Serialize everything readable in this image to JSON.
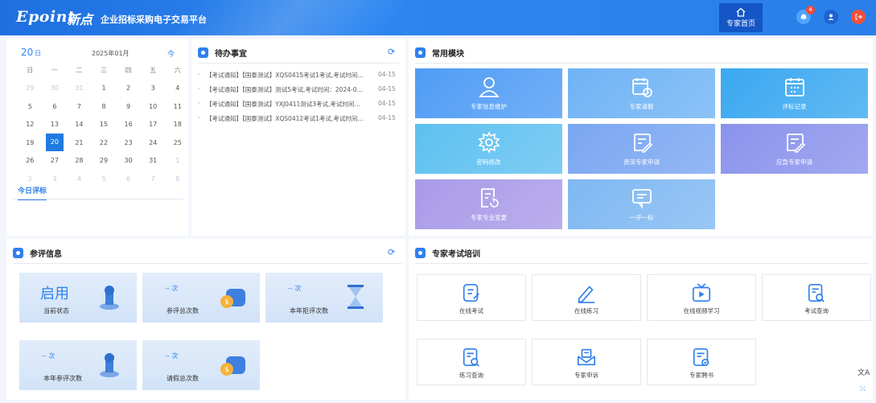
{
  "header": {
    "logo_text": "Epoint",
    "logo_cn": "新点",
    "title": "企业招标采购电子交易平台",
    "home_label": "专家首页",
    "notification_count": "4"
  },
  "calendar": {
    "day": "20",
    "day_unit": "日",
    "month": "2025年01月",
    "today_btn": "今",
    "weekdays": [
      "日",
      "一",
      "二",
      "三",
      "四",
      "五",
      "六"
    ],
    "weeks": [
      [
        "29",
        "30",
        "31",
        "1",
        "2",
        "3",
        "4"
      ],
      [
        "5",
        "6",
        "7",
        "8",
        "9",
        "10",
        "11"
      ],
      [
        "12",
        "13",
        "14",
        "15",
        "16",
        "17",
        "18"
      ],
      [
        "19",
        "20",
        "21",
        "22",
        "23",
        "24",
        "25"
      ],
      [
        "26",
        "27",
        "28",
        "29",
        "30",
        "31",
        "1"
      ],
      [
        "2",
        "3",
        "4",
        "5",
        "6",
        "7",
        "8"
      ]
    ],
    "today_review": "今日评标"
  },
  "todo": {
    "title": "待办事宜",
    "items": [
      {
        "text": "【考试通知】【国泰测试】XQS0415考试1考试,考试时间…",
        "date": "04-15"
      },
      {
        "text": "【考试通知】【国泰测试】测试5考试,考试时间：2024-0…",
        "date": "04-15"
      },
      {
        "text": "【考试通知】【国泰测试】YXJ0411测试3考试,考试时间…",
        "date": "04-15"
      },
      {
        "text": "【考试通知】【国泰测试】XQS0412考试1考试,考试时间…",
        "date": "04-15"
      }
    ]
  },
  "modules": {
    "title": "常用模块",
    "tiles": [
      {
        "label": "专家信息维护",
        "icon": "user-icon",
        "color": "#4f9cf5"
      },
      {
        "label": "专家请假",
        "icon": "calendar-clock-icon",
        "color": "#6fb3f5"
      },
      {
        "label": "评标记录",
        "icon": "calendar-icon",
        "color": "#3aa8f0"
      },
      {
        "label": "密码修改",
        "icon": "gear-icon",
        "color": "#5ec0f0"
      },
      {
        "label": "资深专家申请",
        "icon": "edit-doc-icon",
        "color": "#7aa6f2"
      },
      {
        "label": "应急专家申请",
        "icon": "edit-doc-icon",
        "color": "#8a93ec"
      },
      {
        "label": "专家专业变更",
        "icon": "doc-refresh-icon",
        "color": "#a99ae8"
      },
      {
        "label": "一评一标",
        "icon": "message-icon",
        "color": "#7fb8f2"
      }
    ]
  },
  "review": {
    "title": "参评信息",
    "stats": [
      {
        "value": "启用",
        "label": "当前状态",
        "icon": "stamp-icon"
      },
      {
        "value": "-- 次",
        "label": "参评总次数",
        "icon": "coin-wallet-icon"
      },
      {
        "value": "-- 次",
        "label": "本年拒评次数",
        "icon": "hourglass-icon"
      },
      {
        "value": "-- 次",
        "label": "本年参评次数",
        "icon": "stamp-icon"
      },
      {
        "value": "-- 次",
        "label": "请假总次数",
        "icon": "coin-wallet-icon"
      }
    ]
  },
  "training": {
    "title": "专家考试培训",
    "cards": [
      {
        "label": "在线考试",
        "icon": "exam-icon"
      },
      {
        "label": "在线练习",
        "icon": "pen-icon"
      },
      {
        "label": "在线视频学习",
        "icon": "video-icon"
      },
      {
        "label": "考试查询",
        "icon": "doc-search-icon"
      },
      {
        "label": "练习查询",
        "icon": "doc-search-icon"
      },
      {
        "label": "专家申诉",
        "icon": "mail-icon"
      },
      {
        "label": "专家聘书",
        "icon": "certificate-icon"
      }
    ]
  },
  "side_tools": {
    "translate_glyph": "文A"
  }
}
